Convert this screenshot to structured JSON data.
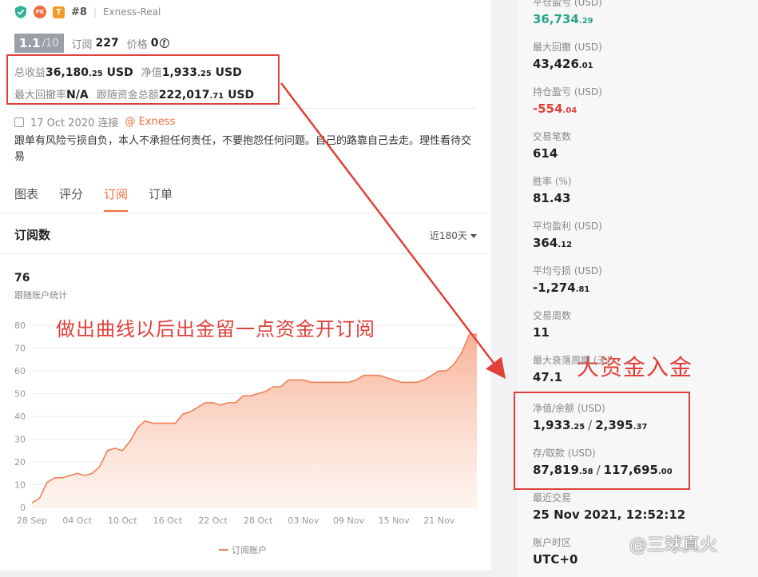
{
  "header": {
    "shield_icon": "shield-check-icon",
    "pk_badge": "PK",
    "t_badge": "T",
    "rank": "#8",
    "account": "Exness-Real"
  },
  "summary": {
    "score": "1.1",
    "score_den": "/10",
    "subs_label": "订阅",
    "subs_value": "227",
    "price_label": "价格",
    "price_value": "0",
    "price_icon": "ƒ"
  },
  "stats": {
    "total_profit_label": "总收益",
    "total_profit_int": "36,180",
    "total_profit_dec": ".25",
    "total_profit_unit": "USD",
    "equity_label": "净值",
    "equity_int": "1,933",
    "equity_dec": ".25",
    "equity_unit": "USD",
    "max_dd_label": "最大回撤率",
    "max_dd_value": "N/A",
    "follow_label": "跟随资金总额",
    "follow_int": "222,017",
    "follow_dec": ".71",
    "follow_unit": "USD"
  },
  "meta": {
    "date": "17 Oct 2020 连接",
    "broker": "@ Exness"
  },
  "description": "跟单有风险亏损自负，本人不承担任何责任，不要抱怨任何问题。自己的路靠自己去走。理性看待交易",
  "tabs": [
    "图表",
    "评分",
    "订阅",
    "订单"
  ],
  "section": {
    "title": "订阅数",
    "period": "近180天",
    "count": "76",
    "count_label": "跟随账户统计",
    "legend": "订阅账户"
  },
  "annotations": {
    "left": "做出曲线以后出金留一点资金开订阅",
    "right": "大资金入金"
  },
  "metrics": [
    {
      "label": "平仓盈亏 (USD)",
      "int": "36,734",
      "dec": ".29",
      "color": "green"
    },
    {
      "label": "最大回撤 (USD)",
      "int": "43,426",
      "dec": ".01",
      "color": ""
    },
    {
      "label": "持仓盈亏 (USD)",
      "int": "-554",
      "dec": ".04",
      "color": "red"
    },
    {
      "label": "交易笔数",
      "int": "614",
      "dec": "",
      "color": ""
    },
    {
      "label": "胜率 (%)",
      "int": "81.43",
      "dec": "",
      "color": ""
    },
    {
      "label": "平均盈利 (USD)",
      "int": "364",
      "dec": ".12",
      "color": ""
    },
    {
      "label": "平均亏损 (USD)",
      "int": "-1,274",
      "dec": ".81",
      "color": ""
    },
    {
      "label": "交易周数",
      "int": "11",
      "dec": "",
      "color": ""
    },
    {
      "label": "最大衰落周期 (天)",
      "int": "47.1",
      "dec": "",
      "color": ""
    }
  ],
  "equity_balance": {
    "label": "净值/余额 (USD)",
    "a_int": "1,933",
    "a_dec": ".25",
    "b_int": "2,395",
    "b_dec": ".37"
  },
  "deposit_withdraw": {
    "label": "存/取款 (USD)",
    "a_int": "87,819",
    "a_dec": ".58",
    "b_int": "117,695",
    "b_dec": ".00"
  },
  "last_trade": {
    "label": "最近交易",
    "value": "25 Nov 2021, 12:52:12"
  },
  "timezone": {
    "label": "账户时区",
    "value": "UTC+0"
  },
  "watermark": "@三球真火",
  "colors": {
    "accent": "#f26b3a",
    "green": "#26a68a",
    "red": "#e0403a"
  },
  "chart_data": {
    "type": "area",
    "title": "",
    "xlabel": "",
    "ylabel": "",
    "ylim": [
      0,
      80
    ],
    "yticks": [
      0,
      10,
      20,
      30,
      40,
      50,
      60,
      70,
      80
    ],
    "x_tick_labels": [
      "28 Sep",
      "04 Oct",
      "10 Oct",
      "16 Oct",
      "22 Oct",
      "28 Oct",
      "03 Nov",
      "09 Nov",
      "15 Nov",
      "21 Nov"
    ],
    "x_days": [
      0,
      6,
      12,
      18,
      24,
      30,
      36,
      42,
      48,
      54
    ],
    "series": [
      {
        "name": "订阅账户",
        "x": [
          0,
          1,
          2,
          3,
          4,
          5,
          6,
          7,
          8,
          9,
          10,
          11,
          12,
          13,
          14,
          15,
          16,
          17,
          18,
          19,
          20,
          21,
          22,
          23,
          24,
          25,
          26,
          27,
          28,
          29,
          30,
          31,
          32,
          33,
          34,
          35,
          36,
          37,
          38,
          39,
          40,
          41,
          42,
          43,
          44,
          45,
          46,
          47,
          48,
          49,
          50,
          51,
          52,
          53,
          54,
          55,
          56,
          57,
          58,
          59
        ],
        "y": [
          2,
          4,
          11,
          13,
          13,
          14,
          15,
          14,
          15,
          18,
          25,
          26,
          25,
          29,
          35,
          38,
          37,
          37,
          37,
          37,
          41,
          42,
          44,
          46,
          46,
          45,
          46,
          46,
          49,
          49,
          50,
          51,
          53,
          53,
          56,
          56,
          56,
          55,
          55,
          55,
          55,
          55,
          55,
          56,
          58,
          58,
          58,
          57,
          56,
          55,
          55,
          55,
          56,
          58,
          60,
          60,
          63,
          68,
          76,
          76
        ]
      }
    ]
  }
}
